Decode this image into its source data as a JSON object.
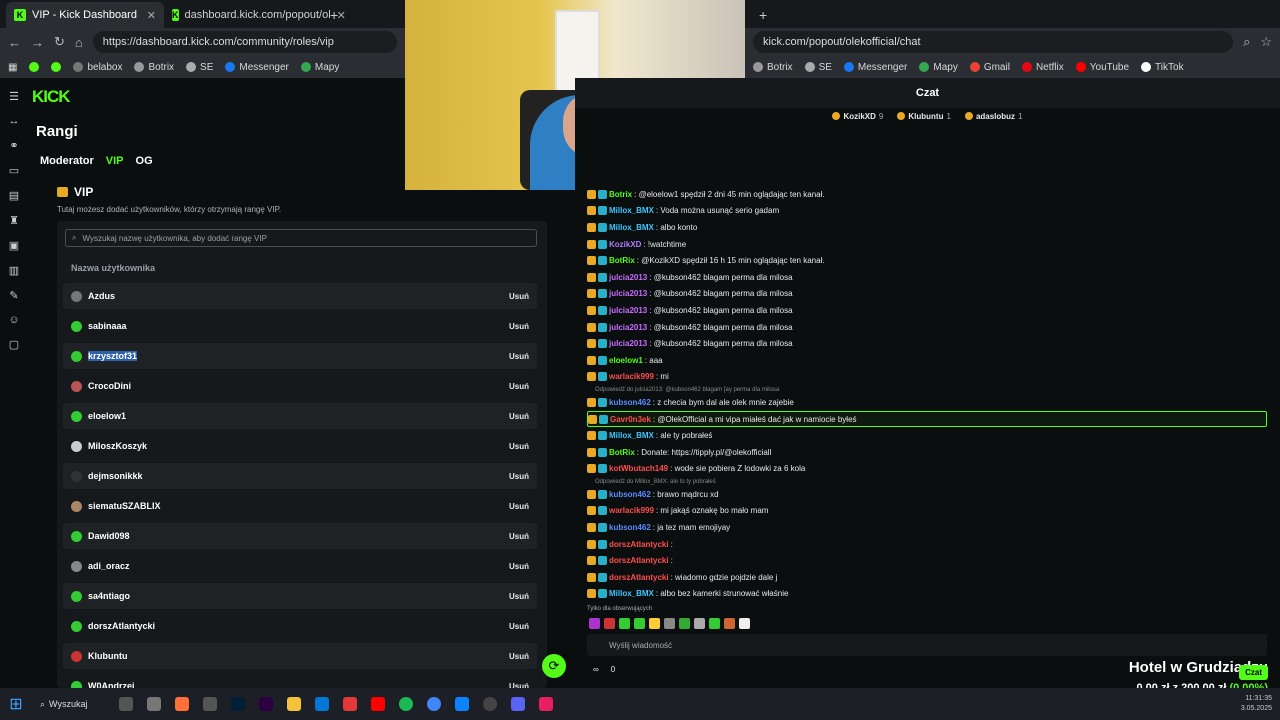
{
  "left_browser": {
    "tab1": "VIP - Kick Dashboard",
    "tab2": "dashboard.kick.com/popout/ol",
    "url": "https://dashboard.kick.com/community/roles/vip",
    "bookmarks": [
      "belabox",
      "Botrix",
      "SE",
      "",
      "Messenger",
      "Mapy"
    ]
  },
  "right_browser": {
    "url": "kick.com/popout/olekofficial/chat",
    "bookmarks": [
      "Botrix",
      "SE",
      "Messenger",
      "Mapy",
      "Gmail",
      "Netflix",
      "YouTube",
      "TikTok"
    ]
  },
  "dashboard": {
    "logo": "KICK",
    "page_title": "Rangi",
    "role_tabs": [
      "Moderator",
      "VIP",
      "OG"
    ],
    "vip_title": "VIP",
    "vip_desc": "Tutaj możesz dodać użytkowników, którzy otrzymają rangę VIP.",
    "search_placeholder": "Wyszukaj nazwę użytkownika, aby dodać rangę VIP",
    "col_header": "Nazwa użytkownika",
    "remove_label": "Usuń",
    "users": [
      "Azdus",
      "sabinaaa",
      "krzysztof31",
      "CrocoDini",
      "eloelow1",
      "MiloszKoszyk",
      "dejmsonikkk",
      "siematuSZABLIX",
      "Dawid098",
      "adi_oracz",
      "sa4ntiago",
      "dorszAtlantycki",
      "Klubuntu",
      "W0Andrzej"
    ]
  },
  "chat": {
    "title": "Czat",
    "gifts": [
      {
        "name": "KozikXD",
        "n": "9"
      },
      {
        "name": "Klubuntu",
        "n": "1"
      },
      {
        "name": "adaslobuz",
        "n": "1"
      }
    ],
    "messages": [
      {
        "user": "Botrix",
        "color": "#53fc18",
        "text": "@eloelow1 spędził 2 dni 45 min oglądając ten kanał."
      },
      {
        "user": "Millox_BMX",
        "color": "#3ec6ff",
        "text": "Voda można usunąć serio gadam"
      },
      {
        "user": "Millox_BMX",
        "color": "#3ec6ff",
        "text": "albo konto"
      },
      {
        "user": "KozikXD",
        "color": "#b07cff",
        "text": "!watchtime"
      },
      {
        "user": "BotRix",
        "color": "#53fc18",
        "text": "@KozikXD spędził 16 h 15 min oglądając ten kanał."
      },
      {
        "user": "julcia2013",
        "color": "#c86cff",
        "text": "@kubson462 blagam    perma dla milosa"
      },
      {
        "user": "julcia2013",
        "color": "#c86cff",
        "text": "@kubson462 blagam    perma dla milosa"
      },
      {
        "user": "julcia2013",
        "color": "#c86cff",
        "text": "@kubson462 blagam    perma dla milosa"
      },
      {
        "user": "julcia2013",
        "color": "#c86cff",
        "text": "@kubson462 blagam    perma dla milosa"
      },
      {
        "user": "julcia2013",
        "color": "#c86cff",
        "text": "@kubson462 blagam    perma dla milosa"
      },
      {
        "user": "eloelow1",
        "color": "#53fc18",
        "text": "aaa"
      },
      {
        "user": "warlacik999",
        "color": "#ff4d4d",
        "text": "mi"
      },
      {
        "reply": "Odpowiedź do julcia2013: @kubson462 blagam [ay perma dla milosa"
      },
      {
        "user": "kubson462",
        "color": "#5b8cff",
        "text": "z checia bym dal ale olek mnie zajebie"
      },
      {
        "user": "Gavr0n3ek",
        "color": "#ff4d4d",
        "text": "@OlekOfficial a mi vipa miałeś dać jak w namiocie byłeś",
        "hl": true
      },
      {
        "user": "Millox_BMX",
        "color": "#3ec6ff",
        "text": "ale    ty pobrałeś"
      },
      {
        "user": "BotRix",
        "color": "#53fc18",
        "text": "Donate: https://tipply.pl/@olekofficiall"
      },
      {
        "user": "kotWbutach149",
        "color": "#ff4d4d",
        "text": "wode sie pobiera Z lodowki za 6 kola"
      },
      {
        "reply": "Odpowiedź do Millox_BMX: ale to ty pobrałeś"
      },
      {
        "user": "kubson462",
        "color": "#5b8cff",
        "text": "brawo mądrcu xd"
      },
      {
        "user": "warlacik999",
        "color": "#ff4d4d",
        "text": "mi    jakąś oznakę bo mało mam"
      },
      {
        "user": "kubson462",
        "color": "#5b8cff",
        "text": "ja tez mam emojiyay"
      },
      {
        "user": "dorszAtlantycki",
        "color": "#ff4d4d",
        "text": ""
      },
      {
        "user": "dorszAtlantycki",
        "color": "#ff4d4d",
        "text": ""
      },
      {
        "user": "dorszAtlantycki",
        "color": "#ff4d4d",
        "text": "wiadomo gdzie    pojdzie dale j"
      },
      {
        "user": "Millox_BMX",
        "color": "#3ec6ff",
        "text": "albo bez kamerki strunować właśnie"
      }
    ],
    "followers_only": "Tylko dla obserwujących",
    "input_placeholder": "Wyślij wiadomość",
    "viewers": "0",
    "czat_button": "Czat"
  },
  "overlay": {
    "title": "Hotel w Grudziądzu",
    "amount": "0,00 zł",
    "of": "z 200,00 zł",
    "pct": "(0.00%)"
  },
  "taskbar": {
    "search": "Wyszukaj",
    "time": "11:31:35",
    "date": "3.05.2025"
  }
}
